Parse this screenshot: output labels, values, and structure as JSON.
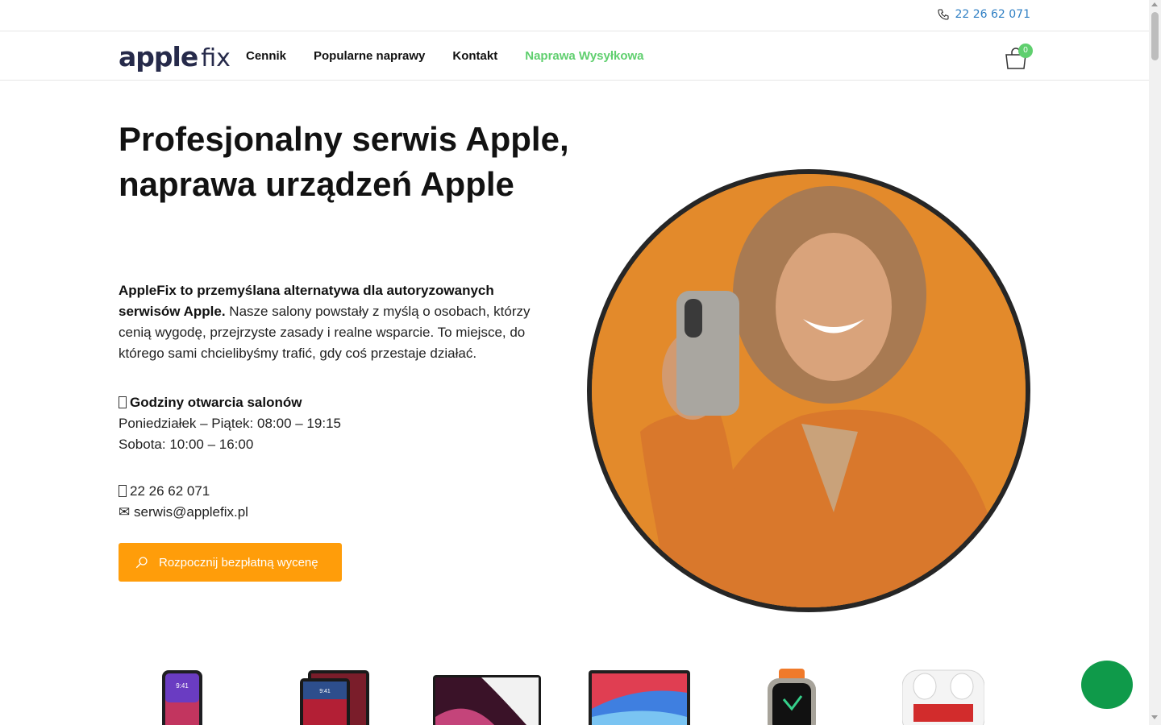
{
  "topbar": {
    "phone": "22 26 62 071"
  },
  "logo": {
    "part1": "apple",
    "part2": "fix"
  },
  "nav": {
    "items": [
      {
        "label": "Cennik"
      },
      {
        "label": "Popularne naprawy"
      },
      {
        "label": "Kontakt"
      },
      {
        "label": "Naprawa Wysyłkowa"
      }
    ],
    "cart_count": "0"
  },
  "hero": {
    "title": "Profesjonalny serwis Apple, naprawa urządzeń Apple",
    "intro_bold": "AppleFix to przemyślana alternatywa dla autoryzowanych serwisów Apple.",
    "intro_rest": " Nasze salony powstały z myślą o osobach, którzy cenią wygodę, przejrzyste zasady i realne wsparcie. To miejsce, do którego sami chcielibyśmy trafić, gdy coś przestaje działać.",
    "hours_title": "Godziny otwarcia salonów",
    "hours_weekdays": "Poniedziałek – Piątek: 08:00 – 19:15",
    "hours_saturday": "Sobota: 10:00 – 16:00",
    "phone": "22 26 62 071",
    "email_glyph": "✉",
    "email": "serwis@applefix.pl",
    "cta_label": "Rozpocznij bezpłatną wycenę"
  },
  "devices": [
    {
      "name": "iphone"
    },
    {
      "name": "ipad"
    },
    {
      "name": "macbook-pro"
    },
    {
      "name": "macbook-air"
    },
    {
      "name": "apple-watch"
    },
    {
      "name": "airpods"
    }
  ],
  "colors": {
    "accent_green": "#5fcf6e",
    "cta_orange": "#ff9d0a",
    "phone_blue": "#2f7fc4",
    "chat_green": "#0f9a4a"
  }
}
